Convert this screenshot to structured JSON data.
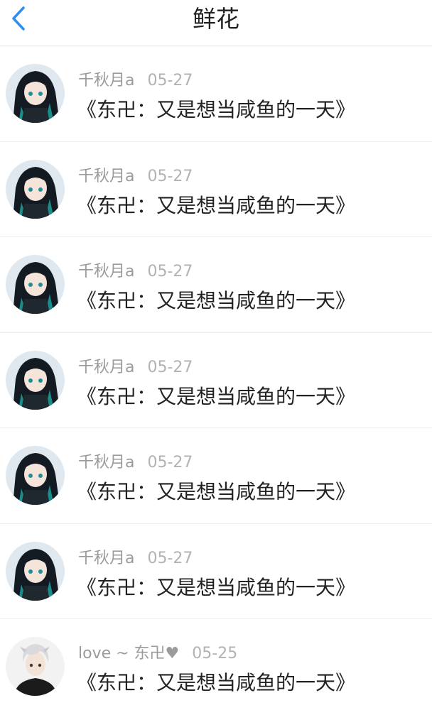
{
  "header": {
    "title": "鲜花",
    "back_icon": "chevron-left-icon",
    "accent_color": "#2f8cf0"
  },
  "items": [
    {
      "username": "千秋月a",
      "date": "05-27",
      "text": "《东卍：又是想当咸鱼的一天》",
      "avatar": "anime-girl-avatar"
    },
    {
      "username": "千秋月a",
      "date": "05-27",
      "text": "《东卍：又是想当咸鱼的一天》",
      "avatar": "anime-girl-avatar"
    },
    {
      "username": "千秋月a",
      "date": "05-27",
      "text": "《东卍：又是想当咸鱼的一天》",
      "avatar": "anime-girl-avatar"
    },
    {
      "username": "千秋月a",
      "date": "05-27",
      "text": "《东卍：又是想当咸鱼的一天》",
      "avatar": "anime-girl-avatar"
    },
    {
      "username": "千秋月a",
      "date": "05-27",
      "text": "《东卍：又是想当咸鱼的一天》",
      "avatar": "anime-girl-avatar"
    },
    {
      "username": "千秋月a",
      "date": "05-27",
      "text": "《东卍：又是想当咸鱼的一天》",
      "avatar": "anime-girl-avatar"
    },
    {
      "username": "love ~ 东卍♥",
      "date": "05-25",
      "text": "《东卍：又是想当咸鱼的一天》",
      "avatar": "white-hair-boy-avatar"
    }
  ]
}
